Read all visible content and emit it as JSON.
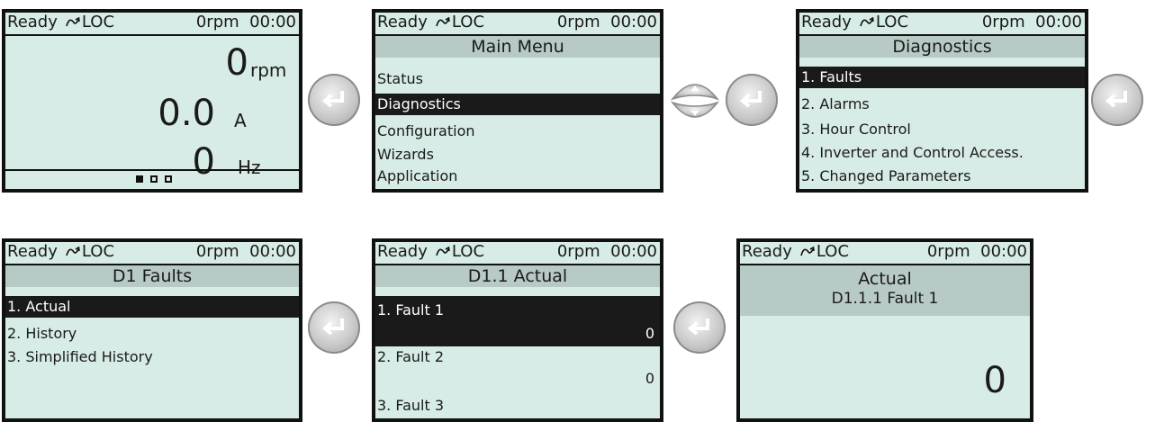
{
  "status": {
    "ready": "Ready",
    "mode": "LOC",
    "speed": "0rpm",
    "time": "00:00"
  },
  "screens": {
    "monitor": {
      "lines": [
        {
          "value": "0",
          "unit": "rpm"
        },
        {
          "value": "0.0",
          "unit": "A"
        },
        {
          "value": "0",
          "unit": "Hz"
        }
      ],
      "page_indicator": {
        "total": 3,
        "active": 1
      }
    },
    "main_menu": {
      "title": "Main Menu",
      "items": [
        "Status",
        "Diagnostics",
        "Configuration",
        "Wizards",
        "Application"
      ],
      "selected": "Diagnostics"
    },
    "diagnostics": {
      "title": "Diagnostics",
      "items": [
        "1. Faults",
        "2. Alarms",
        "3. Hour Control",
        "4. Inverter and Control Access.",
        "5. Changed Parameters"
      ],
      "selected": "1. Faults"
    },
    "d1_faults": {
      "title": "D1 Faults",
      "items": [
        "1. Actual",
        "2. History",
        "3. Simplified History"
      ],
      "selected": "1. Actual"
    },
    "d11_actual": {
      "title": "D1.1 Actual",
      "rows": [
        {
          "name": "1. Fault 1",
          "value": "0"
        },
        {
          "name": "2. Fault 2",
          "value": "0"
        },
        {
          "name": "3. Fault 3",
          "value": ""
        }
      ],
      "selected": "1. Fault 1"
    },
    "fault_detail": {
      "title_line1": "Actual",
      "title_line2": "D1.1.1 Fault 1",
      "value": "0"
    }
  },
  "icons": {
    "enter": "enter-key-icon",
    "updown": "up-down-arrows-icon",
    "loc": "rotation-arrow-icon"
  },
  "colors": {
    "screen_bg": "#d7ece6",
    "title_bg": "#b7cac5",
    "selection_bg": "#1a1a1a",
    "border": "#111111"
  }
}
